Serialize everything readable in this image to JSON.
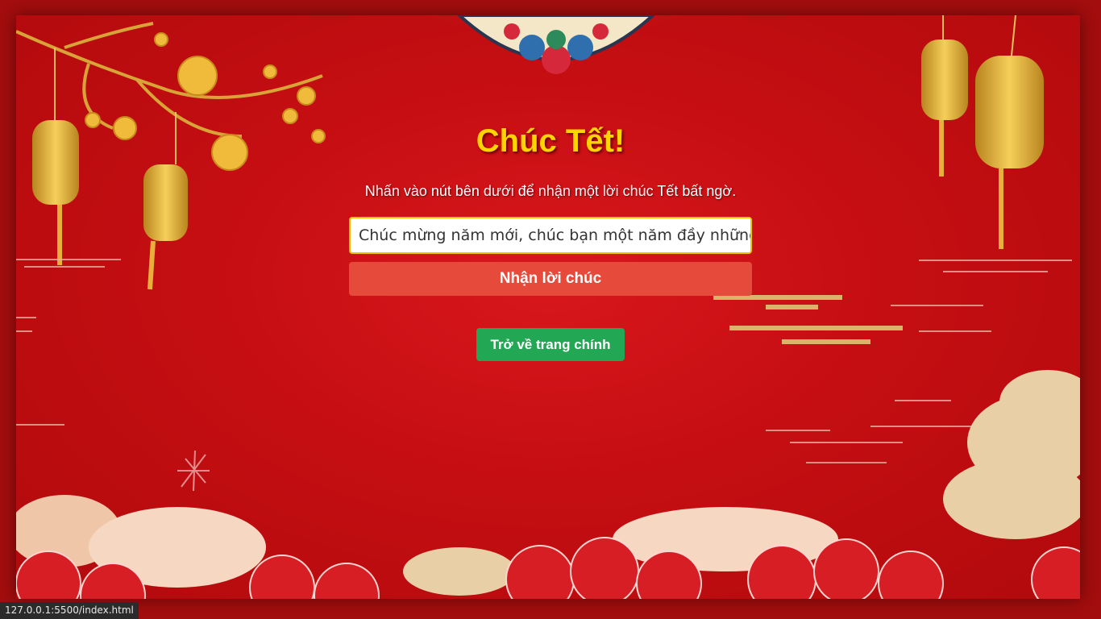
{
  "page": {
    "title": "Chúc Tết!",
    "subtitle": "Nhấn vào nút bên dưới để nhận một lời chúc Tết bất ngờ.",
    "wish_value": "Chúc mừng năm mới, chúc bạn một năm đầy những bư",
    "get_wish_label": "Nhận lời chúc",
    "back_label": "Trở về trang chính"
  },
  "status_bar": {
    "url": "127.0.0.1:5500/index.html"
  },
  "colors": {
    "background": "#c50e12",
    "title": "#ffd400",
    "wish_button": "#e64a3b",
    "back_button": "#22a854",
    "input_border": "#f2c300"
  },
  "icons": [
    "ornament-medallion-icon",
    "plum-blossom-branch-icon",
    "lantern-icon",
    "cloud-pattern-icon",
    "firework-icon"
  ]
}
